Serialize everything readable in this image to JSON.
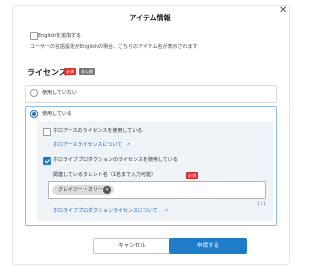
{
  "dialog": {
    "title": "アイテム情報",
    "close": "✕"
  },
  "english": {
    "checkbox_label": "Englishを追加する",
    "description": "ユーザーの言語設定がEnglishの場合、こちらのアイテム名が表示されます"
  },
  "license": {
    "title": "ライセンス",
    "badge_required": "必須",
    "badge_conditional": "非公開",
    "option_none": "使用していない",
    "option_used": "使用している",
    "hololive_ancient": {
      "checkbox_label": "ホロアースのライセンスを使用している",
      "link": "ホロアースライセンスについて"
    },
    "hololive_production": {
      "checkbox_label": "ホロライブプロダクションのライセンスを使用している",
      "talent_label": "関連しているタレント名（1名まで入力可能）",
      "badge_required": "必須",
      "chip": "クレイジー・オリー",
      "chip_remove": "✕",
      "counter": "1 / 1",
      "link": "ホロライブプロダクションライセンスについて"
    }
  },
  "buttons": {
    "cancel": "キャンセル",
    "submit": "申請する"
  },
  "colors": {
    "accent": "#1f7cc9",
    "required": "#d32f2f",
    "panel": "#eef3f8"
  }
}
